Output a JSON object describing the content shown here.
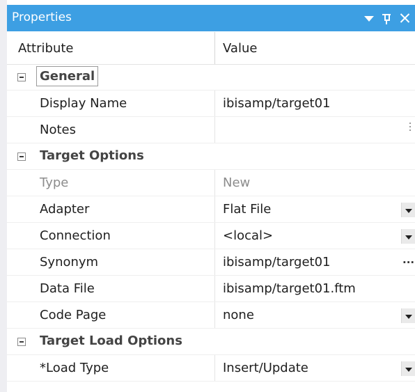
{
  "titlebar": {
    "title": "Properties",
    "dropdown_icon": "chevron-down-icon",
    "pin_icon": "pin-icon",
    "close_icon": "close-icon",
    "color": "#3d9fe3"
  },
  "header": {
    "attribute": "Attribute",
    "value": "Value"
  },
  "categories": {
    "general": {
      "label": "General",
      "properties": {
        "display_name": {
          "name": "Display Name",
          "value": "ibisamp/target01"
        },
        "notes": {
          "name": "Notes",
          "value": ""
        }
      }
    },
    "target_options": {
      "label": "Target Options",
      "properties": {
        "type": {
          "name": "Type",
          "value": "New"
        },
        "adapter": {
          "name": "Adapter",
          "value": "Flat File"
        },
        "connection": {
          "name": "Connection",
          "value": "<local>"
        },
        "synonym": {
          "name": "Synonym",
          "value": "ibisamp/target01",
          "button": "..."
        },
        "data_file": {
          "name": "Data File",
          "value": "ibisamp/target01.ftm"
        },
        "code_page": {
          "name": "Code Page",
          "value": "none"
        }
      }
    },
    "target_load_options": {
      "label": "Target Load Options",
      "properties": {
        "load_type": {
          "name": "*Load Type",
          "value": "Insert/Update"
        }
      }
    }
  }
}
